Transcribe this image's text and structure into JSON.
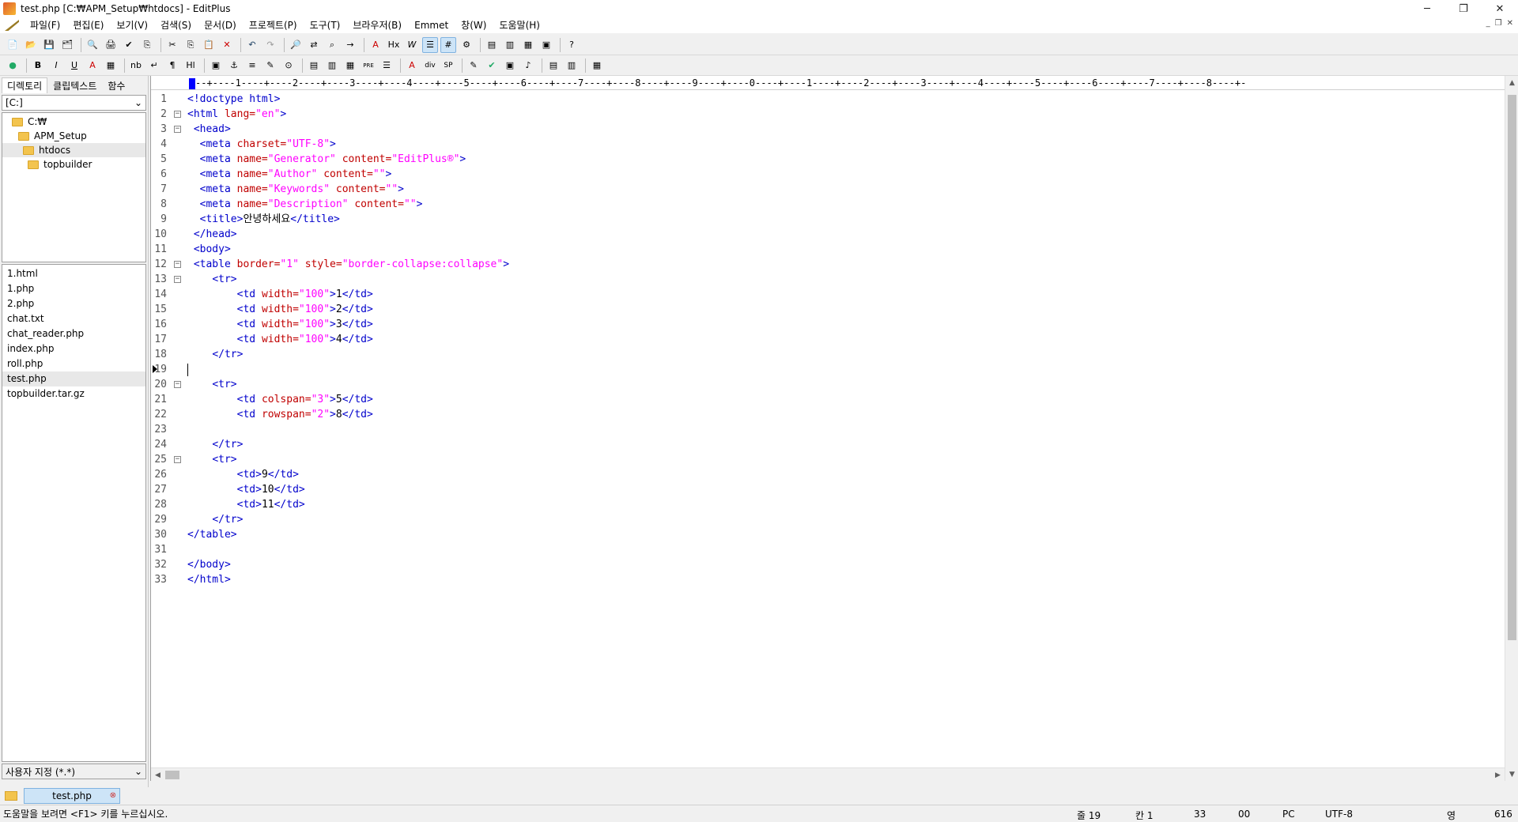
{
  "window": {
    "title": "test.php [C:₩APM_Setup₩htdocs] - EditPlus",
    "controls": [
      "─",
      "❐",
      "✕"
    ]
  },
  "menu": [
    "파일(F)",
    "편집(E)",
    "보기(V)",
    "검색(S)",
    "문서(D)",
    "프로젝트(P)",
    "도구(T)",
    "브라우저(B)",
    "Emmet",
    "창(W)",
    "도움말(H)"
  ],
  "toolbar1": {
    "icons": [
      "new-file-icon",
      "open-icon",
      "save-icon",
      "save-all-icon",
      "sep",
      "print-preview-icon",
      "print-icon",
      "spellcheck-icon",
      "browser-icon",
      "sep",
      "cut-icon",
      "copy-icon",
      "paste-icon",
      "delete-icon",
      "sep",
      "undo-icon",
      "redo-icon",
      "sep",
      "find-icon",
      "replace-icon",
      "find-in-files-icon",
      "goto-icon",
      "sep",
      "font-icon",
      "hex-icon",
      "word-wrap-icon",
      "ruler-icon",
      "line-number-icon",
      "settings-icon",
      "sep",
      "window-1-icon",
      "window-2-icon",
      "window-3-icon",
      "window-4-icon",
      "sep",
      "help-icon"
    ]
  },
  "toolbar2": {
    "labels": [
      "🌐",
      "B",
      "I",
      "U",
      "A",
      "▦",
      "nb",
      "↵",
      "¶",
      "Hl",
      "▣",
      "⚓",
      "≡",
      "✎",
      "⊙",
      "▤",
      "▥",
      "▦",
      "PRE",
      "☰",
      "A",
      "div",
      "SP",
      "✎",
      "✔",
      "▣",
      "♪",
      "▤",
      "▥",
      "▦"
    ]
  },
  "left_panel": {
    "tabs": [
      "디렉토리",
      "클립텍스트",
      "함수"
    ],
    "drive": "[C:]",
    "tree": [
      "C:₩",
      "APM_Setup",
      "htdocs",
      "topbuilder"
    ],
    "files": [
      "1.html",
      "1.php",
      "2.php",
      "chat.txt",
      "chat_reader.php",
      "index.php",
      "roll.php",
      "test.php",
      "topbuilder.tar.gz"
    ],
    "filter": "사용자 지정 (*.*)"
  },
  "ruler": "--+----1----+----2----+----3----+----4----+----5----+----6----+----7----+----8----+----9----+----0----+----1----+----2----+----3----+----4----+----5----+----6----+----7----+----8----+-",
  "doc_tab": "test.php",
  "status": {
    "help": "도움말을 보려면 <F1> 키를 누르십시오.",
    "line": "줄 19",
    "col": "칸 1",
    "total": "33",
    "code": "00",
    "eol": "PC",
    "encoding": "UTF-8",
    "mode": "영",
    "size": "616"
  }
}
